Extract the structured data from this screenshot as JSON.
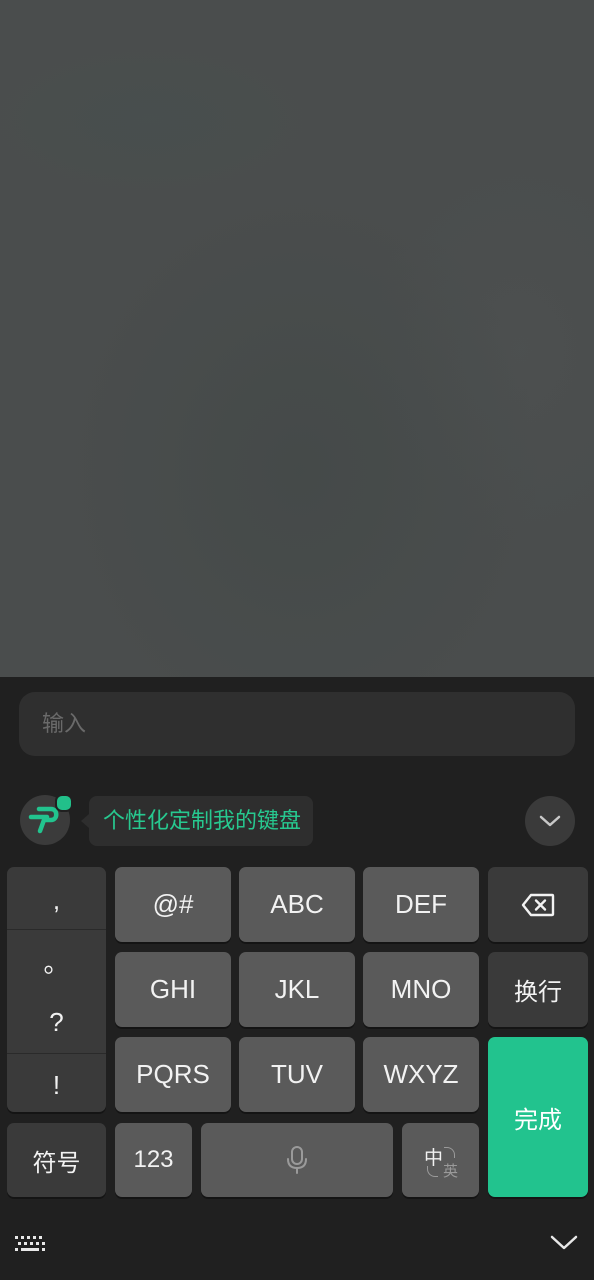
{
  "input": {
    "placeholder": "输入"
  },
  "suggestion": {
    "text": "个性化定制我的键盘"
  },
  "keyboard": {
    "punctuation": [
      ",",
      "。",
      "?",
      "!"
    ],
    "rows": [
      [
        "@#",
        "ABC",
        "DEF"
      ],
      [
        "GHI",
        "JKL",
        "MNO"
      ],
      [
        "PQRS",
        "TUV",
        "WXYZ"
      ]
    ],
    "newline_label": "换行",
    "done_label": "完成",
    "symbols_label": "符号",
    "numbers_label": "123",
    "lang_primary": "中",
    "lang_secondary": "英"
  },
  "colors": {
    "accent": "#22c38e",
    "keyboard_bg": "#202020",
    "key_light": "#5a5a5a",
    "key_dark": "#3a3a3a"
  },
  "icons": {
    "backspace": "backspace-icon",
    "microphone": "microphone-icon",
    "keyboard_toggle": "keyboard-icon",
    "hide_keyboard": "chevron-down-icon",
    "collapse": "chevron-down-icon",
    "logo": "ime-logo-icon"
  }
}
